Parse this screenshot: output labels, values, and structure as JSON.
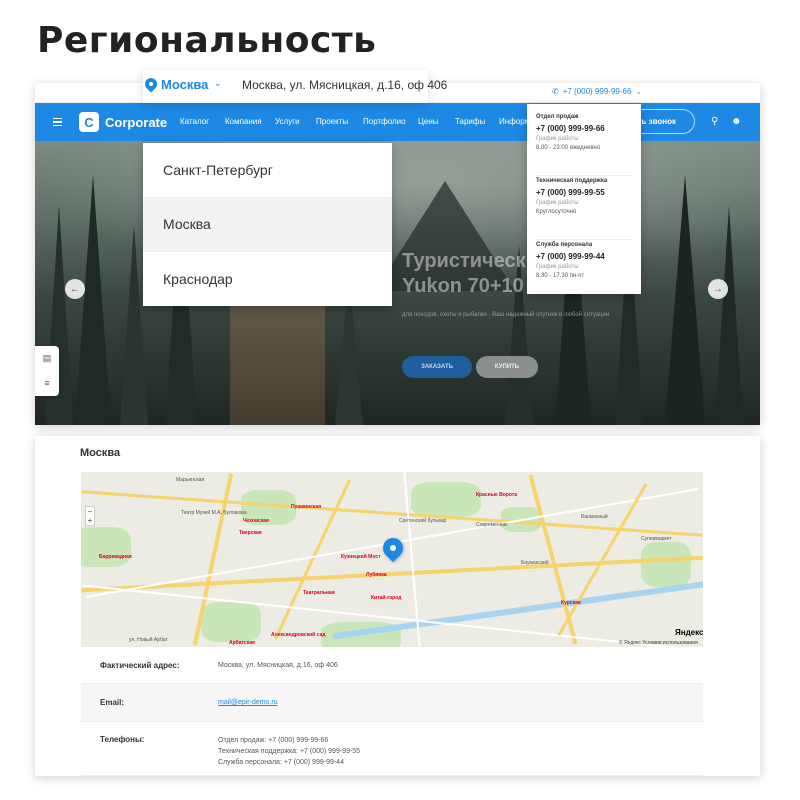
{
  "page_title": "Региональность",
  "header": {
    "top_phone": "+7 (000) 999-99-66",
    "logo_text": "Corporate",
    "nav": [
      "Каталог",
      "Компания",
      "Услуги",
      "Проекты",
      "Портфолио",
      "Цены",
      "Тарифы",
      "Информ"
    ],
    "call_button": "ить звонок"
  },
  "region": {
    "current_city": "Москва",
    "address": "Москва, ул. Мясницкая, д.16, оф 406",
    "options": [
      "Санкт-Петербург",
      "Москва",
      "Краснодар"
    ]
  },
  "phones": [
    {
      "label": "Отдел продаж",
      "number": "+7 (000) 999-99-66",
      "caption": "График работы",
      "hours": "8.00 - 23.00 ежедневно"
    },
    {
      "label": "Техническая поддержка",
      "number": "+7 (000) 999-99-55",
      "caption": "График работы",
      "hours": "Круглосуточно"
    },
    {
      "label": "Служба персонала",
      "number": "+7 (000) 999-99-44",
      "caption": "График работы",
      "hours": "8.30 - 17.30 пн-пт"
    }
  ],
  "hero": {
    "heading": "Туристическ\nYukon 70+10",
    "subtitle": "для походов, охоты и рыбалки - Ваш надежный спутник в любой ситуации",
    "order_button": "ЗАКАЗАТЬ",
    "buy_button": "КУПИТЬ"
  },
  "contacts": {
    "title": "Москва",
    "map": {
      "labels": [
        "Марьинская",
        "Театр Музей М.А. Булгакова",
        "Кузнецкий Мост",
        "Сретенский бульвар",
        "Красные Ворота",
        "Театральная",
        "Китай-город",
        "Тверская",
        "Курская",
        "Баррикадная",
        "Арбатская",
        "Александровский сад",
        "ул. Новый Арбат",
        "Бауманский",
        "Современник",
        "Супермаркет",
        "Басманный",
        "Пушкинская",
        "Чеховская",
        "Лубянка"
      ],
      "yandex": "Яндекс",
      "terms": "© Яндекс  Условия использования"
    },
    "rows": [
      {
        "key": "Фактический адрес:",
        "values": [
          "Москва, ул. Мясницкая, д.16, оф 406"
        ]
      },
      {
        "key": "Email:",
        "values": [
          "mail@epir-demo.ru"
        ]
      },
      {
        "key": "Телефоны:",
        "values": [
          "Отдел продаж: +7 (000) 999-99-66",
          "Техническая поддержка: +7 (000) 999-99-55",
          "Служба персонала: +7 (000) 999-99-44"
        ]
      }
    ]
  },
  "colors": {
    "accent": "#1e88e5",
    "metro": "#dd0022"
  },
  "icons": [
    "menu-icon",
    "search-icon",
    "user-icon",
    "phone-icon",
    "mail-icon",
    "cart-icon",
    "location-pin-icon",
    "chevron-down-icon",
    "arrow-left-icon",
    "arrow-right-icon"
  ]
}
